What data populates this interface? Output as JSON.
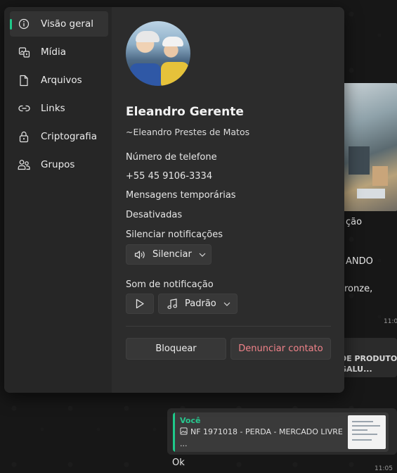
{
  "chat": {
    "text_partial_1": "ção",
    "text_partial_2": "ANDO",
    "text_partial_3": "ronze,",
    "time_1": "11:0",
    "product_card": "DE PRODUTO\nGALU...",
    "reply": {
      "author": "Você",
      "message": "NF 1971018 - PERDA - MERCADO LIVRE",
      "ellipsis": "...",
      "icon": "image-icon"
    },
    "reply_text": "Ok",
    "time_2": "11:05"
  },
  "sidebar": {
    "items": [
      {
        "label": "Visão geral",
        "icon": "info-icon",
        "active": true
      },
      {
        "label": "Mídia",
        "icon": "media-icon",
        "active": false
      },
      {
        "label": "Arquivos",
        "icon": "file-icon",
        "active": false
      },
      {
        "label": "Links",
        "icon": "link-icon",
        "active": false
      },
      {
        "label": "Criptografia",
        "icon": "lock-icon",
        "active": false
      },
      {
        "label": "Grupos",
        "icon": "people-icon",
        "active": false
      }
    ]
  },
  "profile": {
    "name": "Eleandro Gerente",
    "alias": "~Eleandro Prestes de Matos",
    "phone_label": "Número de telefone",
    "phone": "+55 45 9106-3334",
    "temp_label": "Mensagens temporárias",
    "temp_value": "Desativadas",
    "mute_label": "Silenciar notificações",
    "mute_button": "Silenciar",
    "sound_label": "Som de notificação",
    "sound_value": "Padrão",
    "block_button": "Bloquear",
    "report_button": "Denunciar contato"
  },
  "colors": {
    "accent": "#1fc98a",
    "danger": "#f1838a"
  }
}
